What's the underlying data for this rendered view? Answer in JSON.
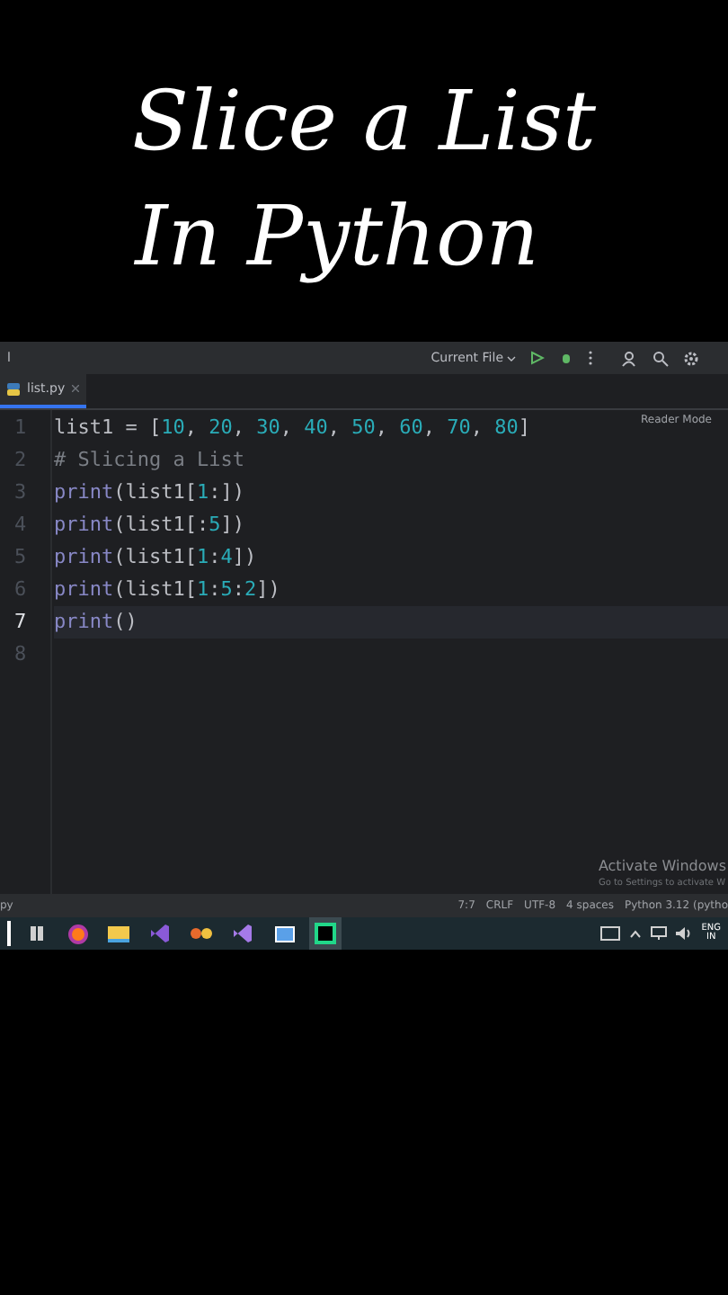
{
  "video_title": [
    "Slice a List",
    "In Python"
  ],
  "toolbar": {
    "project": "l",
    "run_config": "Current File"
  },
  "tabs": [
    {
      "label": "list.py",
      "selected": true
    }
  ],
  "reader_mode": "Reader Mode",
  "code_lines": [
    {
      "number": "1",
      "current": false,
      "tokens": [
        {
          "text": "list1 = [",
          "kind": "plain"
        },
        {
          "text": "10",
          "kind": "number"
        },
        {
          "text": ", ",
          "kind": "plain"
        },
        {
          "text": "20",
          "kind": "number"
        },
        {
          "text": ", ",
          "kind": "plain"
        },
        {
          "text": "30",
          "kind": "number"
        },
        {
          "text": ", ",
          "kind": "plain"
        },
        {
          "text": "40",
          "kind": "number"
        },
        {
          "text": ", ",
          "kind": "plain"
        },
        {
          "text": "50",
          "kind": "number"
        },
        {
          "text": ", ",
          "kind": "plain"
        },
        {
          "text": "60",
          "kind": "number"
        },
        {
          "text": ", ",
          "kind": "plain"
        },
        {
          "text": "70",
          "kind": "number"
        },
        {
          "text": ", ",
          "kind": "plain"
        },
        {
          "text": "80",
          "kind": "number"
        },
        {
          "text": "]",
          "kind": "plain"
        }
      ]
    },
    {
      "number": "2",
      "current": false,
      "tokens": [
        {
          "text": "# Slicing a List",
          "kind": "comment"
        }
      ]
    },
    {
      "number": "3",
      "current": false,
      "tokens": [
        {
          "text": "print",
          "kind": "builtin"
        },
        {
          "text": "(list1[",
          "kind": "plain"
        },
        {
          "text": "1",
          "kind": "number"
        },
        {
          "text": ":])",
          "kind": "plain"
        }
      ]
    },
    {
      "number": "4",
      "current": false,
      "tokens": [
        {
          "text": "print",
          "kind": "builtin"
        },
        {
          "text": "(list1[:",
          "kind": "plain"
        },
        {
          "text": "5",
          "kind": "number"
        },
        {
          "text": "])",
          "kind": "plain"
        }
      ]
    },
    {
      "number": "5",
      "current": false,
      "tokens": [
        {
          "text": "print",
          "kind": "builtin"
        },
        {
          "text": "(list1[",
          "kind": "plain"
        },
        {
          "text": "1",
          "kind": "number"
        },
        {
          "text": ":",
          "kind": "plain"
        },
        {
          "text": "4",
          "kind": "number"
        },
        {
          "text": "])",
          "kind": "plain"
        }
      ]
    },
    {
      "number": "6",
      "current": false,
      "tokens": [
        {
          "text": "print",
          "kind": "builtin"
        },
        {
          "text": "(list1[",
          "kind": "plain"
        },
        {
          "text": "1",
          "kind": "number"
        },
        {
          "text": ":",
          "kind": "plain"
        },
        {
          "text": "5",
          "kind": "number"
        },
        {
          "text": ":",
          "kind": "plain"
        },
        {
          "text": "2",
          "kind": "number"
        },
        {
          "text": "])",
          "kind": "plain"
        }
      ]
    },
    {
      "number": "7",
      "current": true,
      "tokens": [
        {
          "text": "print",
          "kind": "builtin"
        },
        {
          "text": "()",
          "kind": "plain"
        }
      ]
    },
    {
      "number": "8",
      "current": false
    }
  ],
  "activation": {
    "title": "Activate Windows",
    "subtitle": "Go to Settings to activate W"
  },
  "status_bar": {
    "left": "py",
    "items": [
      "7:7",
      "CRLF",
      "UTF-8",
      "4 spaces",
      "Python 3.12 (pytho"
    ]
  },
  "tray": {
    "lang": "ENG",
    "region": "IN"
  }
}
